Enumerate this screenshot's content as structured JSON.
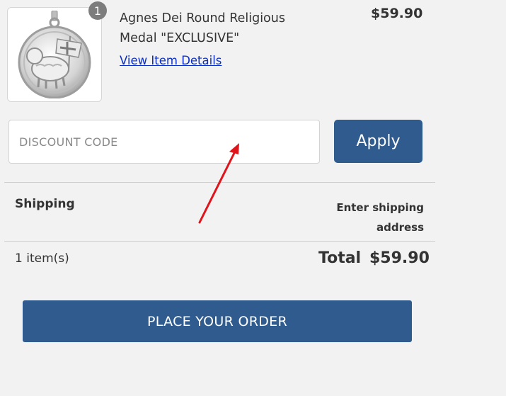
{
  "cart_item": {
    "quantity": "1",
    "title_line1": "Agnes Dei Round Religious",
    "title_line2": "Medal \"EXCLUSIVE\"",
    "price": "$59.90",
    "details_link": "View Item Details",
    "image_icon": "medal-icon"
  },
  "discount": {
    "placeholder": "DISCOUNT CODE",
    "apply_label": "Apply"
  },
  "shipping": {
    "label": "Shipping",
    "value_line1": "Enter shipping",
    "value_line2": "address"
  },
  "summary": {
    "items_count": "1 item(s)",
    "total_label": "Total",
    "total_value": "$59.90"
  },
  "order": {
    "button_label": "PLACE YOUR ORDER"
  },
  "colors": {
    "accent": "#2f5b8f",
    "link": "#0b2fc4",
    "annotation_arrow": "#e0141b",
    "background": "#f2f2f2"
  }
}
